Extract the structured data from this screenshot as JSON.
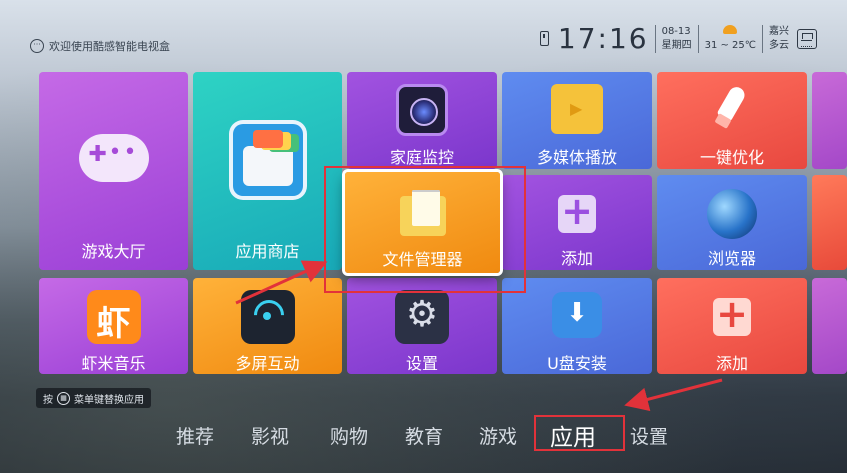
{
  "status_bar": {
    "welcome_text": "欢迎使用酷感智能电视盒",
    "time": "17:16",
    "date": "08-13",
    "weekday": "星期四",
    "temperature": "31 ~ 25℃",
    "city": "嘉兴",
    "weather": "多云"
  },
  "tiles": {
    "game_hall": "游戏大厅",
    "app_store": "应用商店",
    "home_monitor": "家庭监控",
    "media_player": "多媒体播放",
    "one_click_optimize": "一键优化",
    "file_manager": "文件管理器",
    "add_1": "添加",
    "browser": "浏览器",
    "xiami_music": "虾米音乐",
    "multiscreen": "多屏互动",
    "settings": "设置",
    "usb_install": "U盘安装",
    "add_2": "添加"
  },
  "hint": {
    "prefix": "按",
    "text": "菜单键替换应用"
  },
  "nav": {
    "items": [
      "推荐",
      "影视",
      "购物",
      "教育",
      "游戏",
      "应用",
      "设置"
    ],
    "active": "应用"
  },
  "colors": {
    "highlight_red": "#e2323a",
    "tile_purple": "#9a3fd6",
    "tile_teal": "#18a9b8",
    "tile_orange": "#f08a10"
  }
}
